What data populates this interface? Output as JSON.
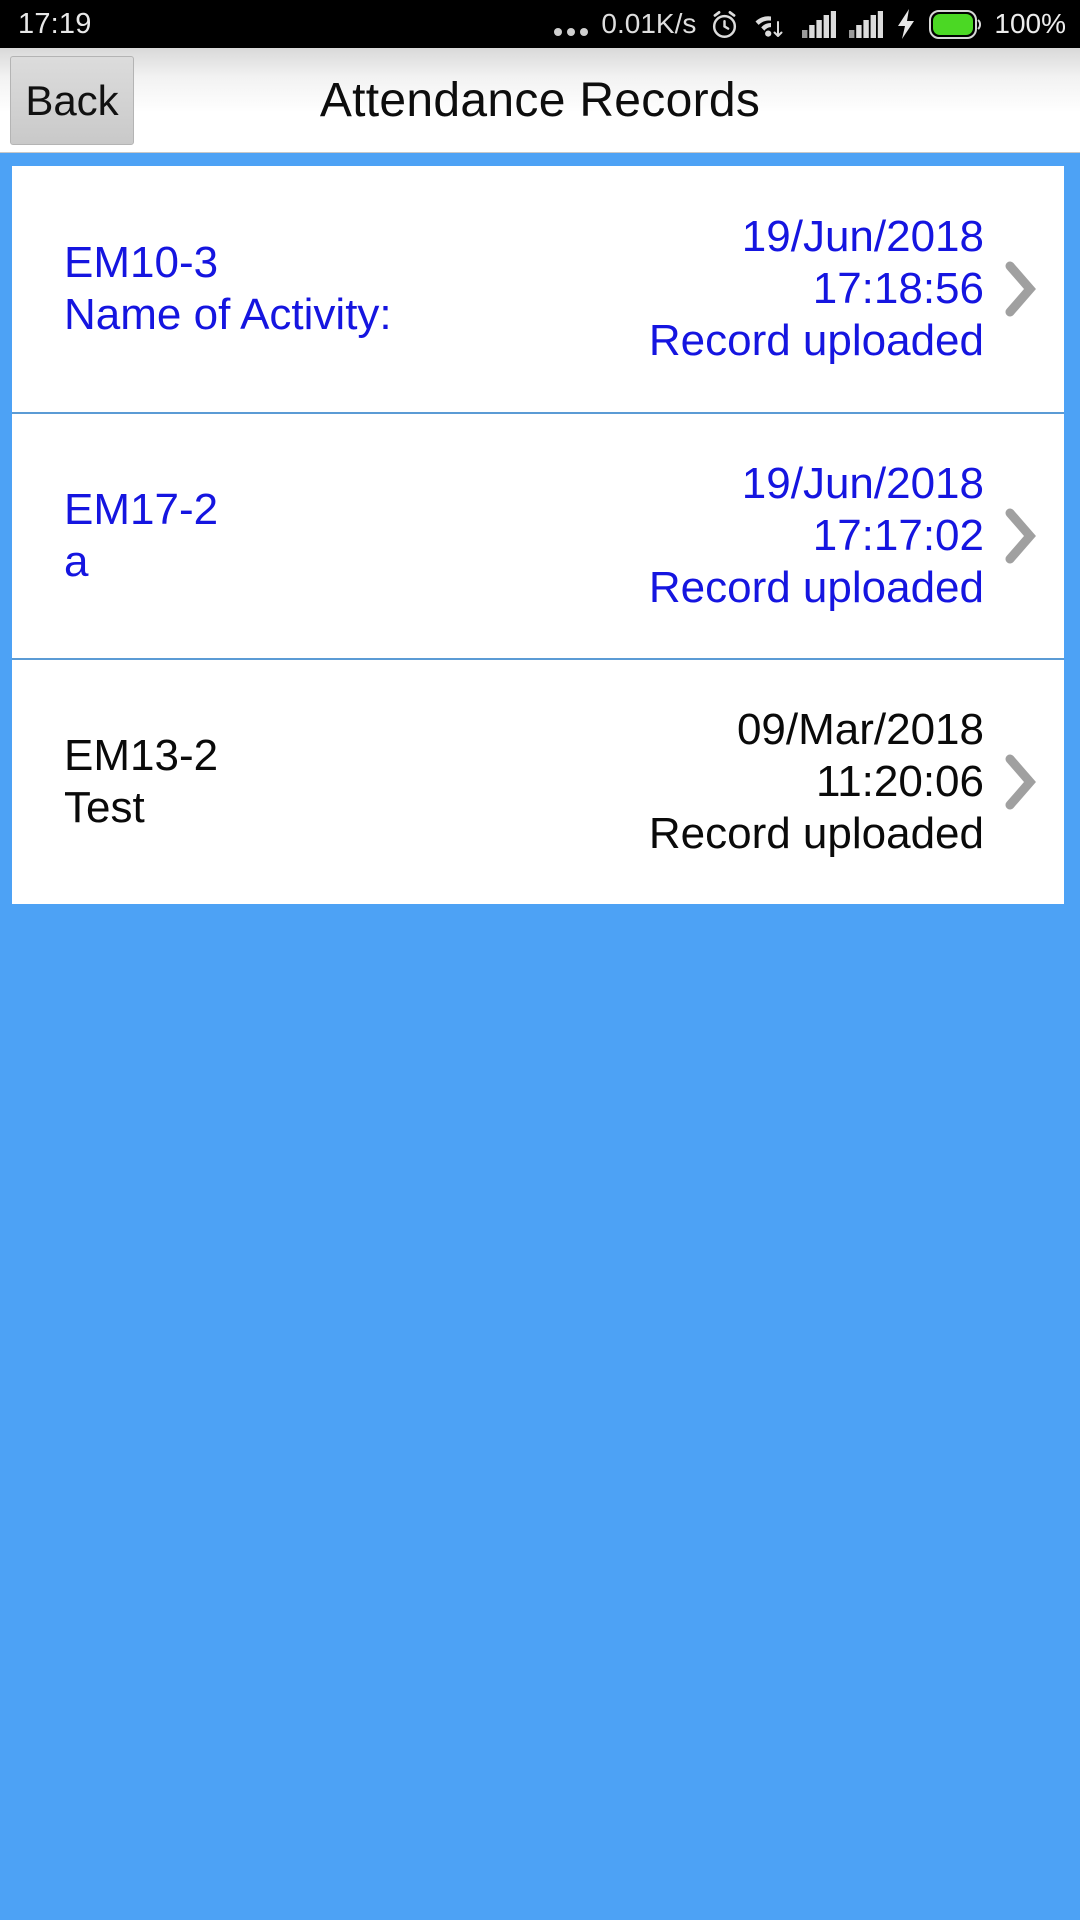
{
  "status_bar": {
    "time": "17:19",
    "network_speed": "0.01K/s",
    "battery_percent": "100%",
    "icons": [
      "more-dots-icon",
      "alarm-icon",
      "wifi-icon",
      "signal-icon",
      "signal-icon",
      "charging-bolt-icon",
      "battery-icon"
    ],
    "battery_color": "#4bd824",
    "background": "#000000"
  },
  "header": {
    "back_label": "Back",
    "title": "Attendance Records"
  },
  "theme": {
    "page_background": "#4da2f5",
    "card_background": "#ffffff",
    "link_color": "#1515e0",
    "visited_color": "#0a0a0a",
    "divider_color": "#5b9bd5",
    "chevron_color": "#a0a0a0"
  },
  "records": [
    {
      "id": "EM10-3",
      "activity": "Name of Activity:",
      "date": "19/Jun/2018",
      "time": "17:18:56",
      "status": "Record uploaded",
      "state": "unvisited"
    },
    {
      "id": "EM17-2",
      "activity": "a",
      "date": "19/Jun/2018",
      "time": "17:17:02",
      "status": "Record uploaded",
      "state": "unvisited"
    },
    {
      "id": "EM13-2",
      "activity": "Test",
      "date": "09/Mar/2018",
      "time": "11:20:06",
      "status": "Record uploaded",
      "state": "visited"
    }
  ]
}
